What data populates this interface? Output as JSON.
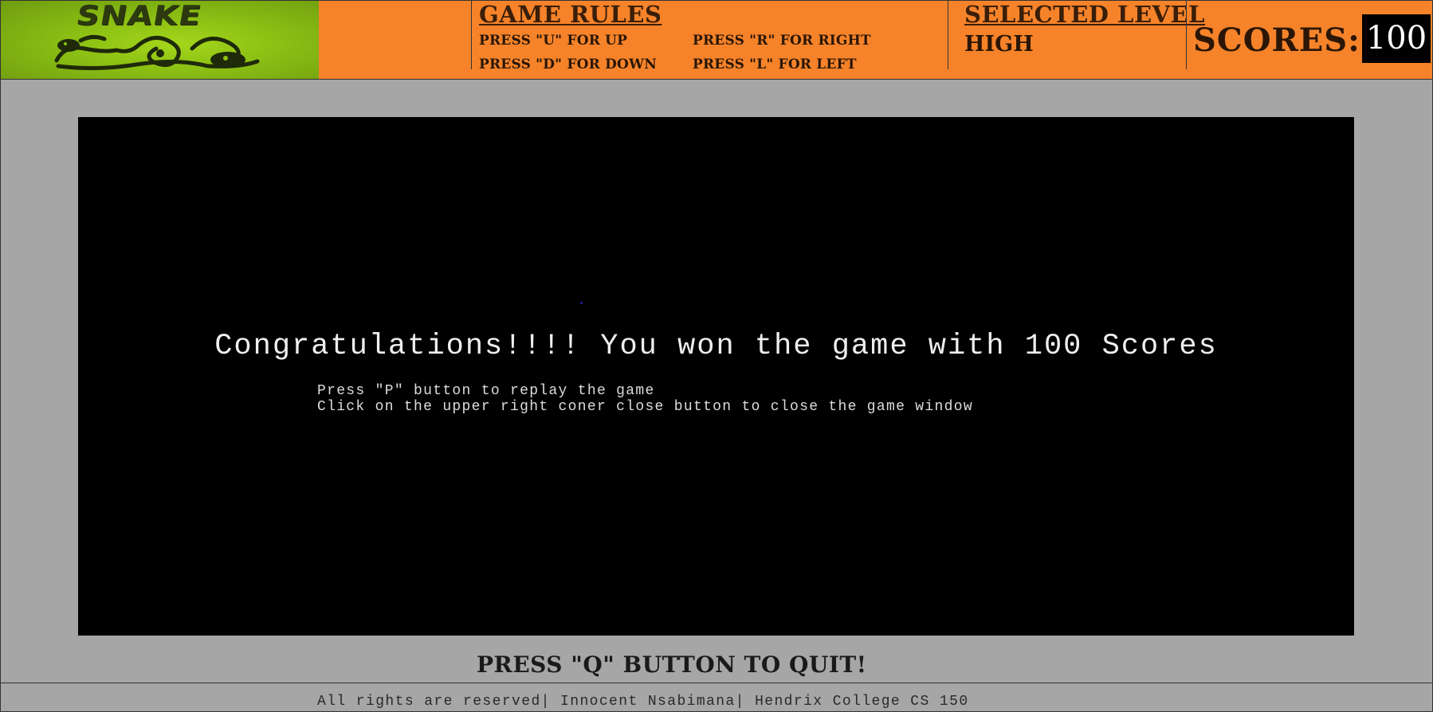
{
  "header": {
    "logo_text": "SNAKE",
    "rules_title": "GAME RULES",
    "rules": [
      "PRESS \"U\" FOR UP",
      "PRESS \"R\" FOR RIGHT",
      "PRESS \"D\" FOR DOWN",
      "PRESS \"L\" FOR LEFT"
    ],
    "level_title": "SELECTED LEVEL",
    "level_value": "HIGH",
    "scores_label": "SCORES:",
    "scores_value": "100"
  },
  "game": {
    "message": "Congratulations!!!! You won the game with 100 Scores",
    "instruction_replay": "Press \"P\" button to replay the game",
    "instruction_close": "Click on the upper right coner close button to close the game window"
  },
  "quit_label": "PRESS \"Q\" BUTTON TO QUIT!",
  "footer_text": "All rights are reserved| Innocent Nsabimana| Hendrix College CS 150",
  "colors": {
    "header_bg": "#f6832a",
    "page_bg": "#a6a6a6",
    "game_bg": "#000000",
    "logo_green": "#8cc114"
  }
}
